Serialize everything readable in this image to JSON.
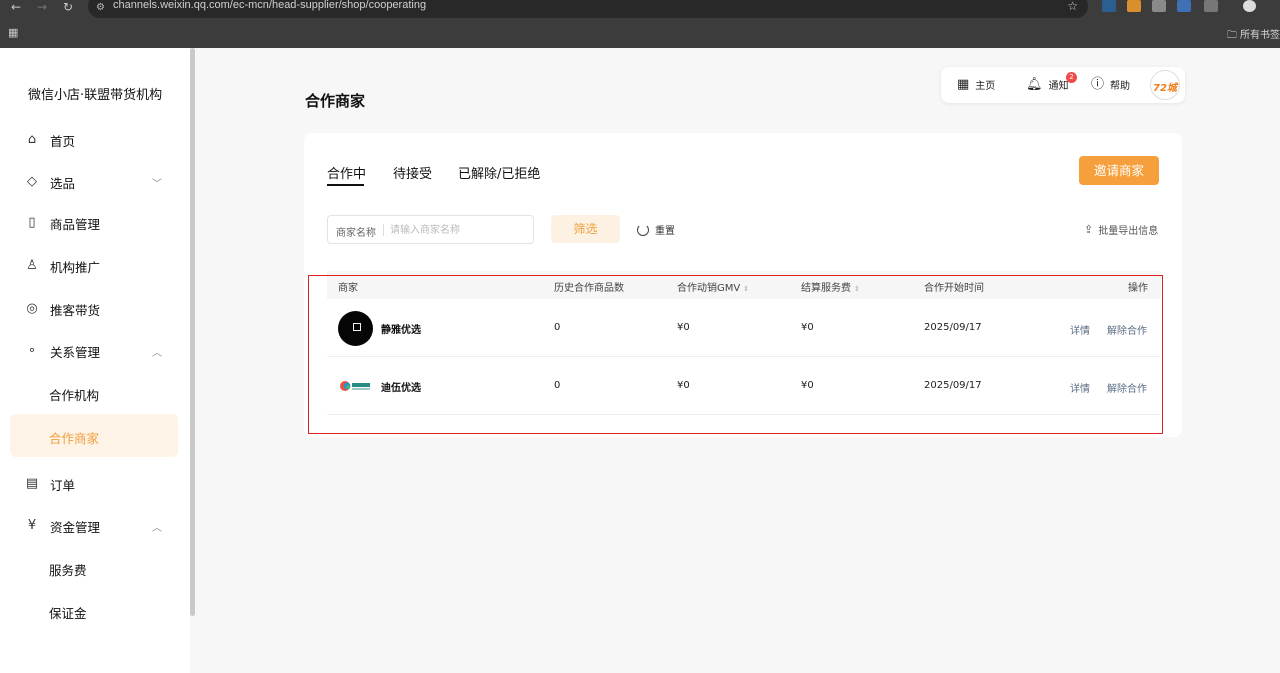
{
  "browser": {
    "url": "channels.weixin.qq.com/ec-mcn/head-supplier/shop/cooperating",
    "bookmarks_label": "所有书签"
  },
  "sidebar": {
    "brand": "微信小店·联盟带货机构",
    "items": [
      {
        "label": "首页",
        "icon": "home-icon"
      },
      {
        "label": "选品",
        "icon": "tag-icon"
      },
      {
        "label": "商品管理",
        "icon": "bag-icon"
      },
      {
        "label": "机构推广",
        "icon": "user-promote-icon"
      },
      {
        "label": "推客带货",
        "icon": "share-icon"
      },
      {
        "label": "关系管理",
        "icon": "relation-icon"
      },
      {
        "label": "订单",
        "icon": "order-icon"
      },
      {
        "label": "资金管理",
        "icon": "yuan-icon"
      }
    ],
    "sub_relation": [
      "合作机构",
      "合作商家"
    ],
    "sub_funds": [
      "服务费",
      "保证金"
    ]
  },
  "userbar": {
    "home": "主页",
    "notify": "通知",
    "notify_count": "2",
    "help": "帮助",
    "avatar_text": "72城"
  },
  "page": {
    "title": "合作商家",
    "tabs": [
      "合作中",
      "待接受",
      "已解除/已拒绝"
    ],
    "invite_button": "邀请商家",
    "filter_label": "商家名称",
    "filter_placeholder": "请输入商家名称",
    "filter_button": "筛选",
    "reset_label": "重置",
    "export_label": "批量导出信息"
  },
  "table": {
    "headers": [
      "商家",
      "历史合作商品数",
      "合作动销GMV",
      "结算服务费",
      "合作开始时间",
      "操作"
    ],
    "rows": [
      {
        "name": "静雅优选",
        "products": "0",
        "gmv": "¥0",
        "fee": "¥0",
        "start": "2025/09/17",
        "op_detail": "详情",
        "op_end": "解除合作"
      },
      {
        "name": "迪伍优选",
        "products": "0",
        "gmv": "¥0",
        "fee": "¥0",
        "start": "2025/09/17",
        "op_detail": "详情",
        "op_end": "解除合作"
      }
    ]
  },
  "colors": {
    "accent": "#f5a03c",
    "annotation_box": "#e02020"
  }
}
